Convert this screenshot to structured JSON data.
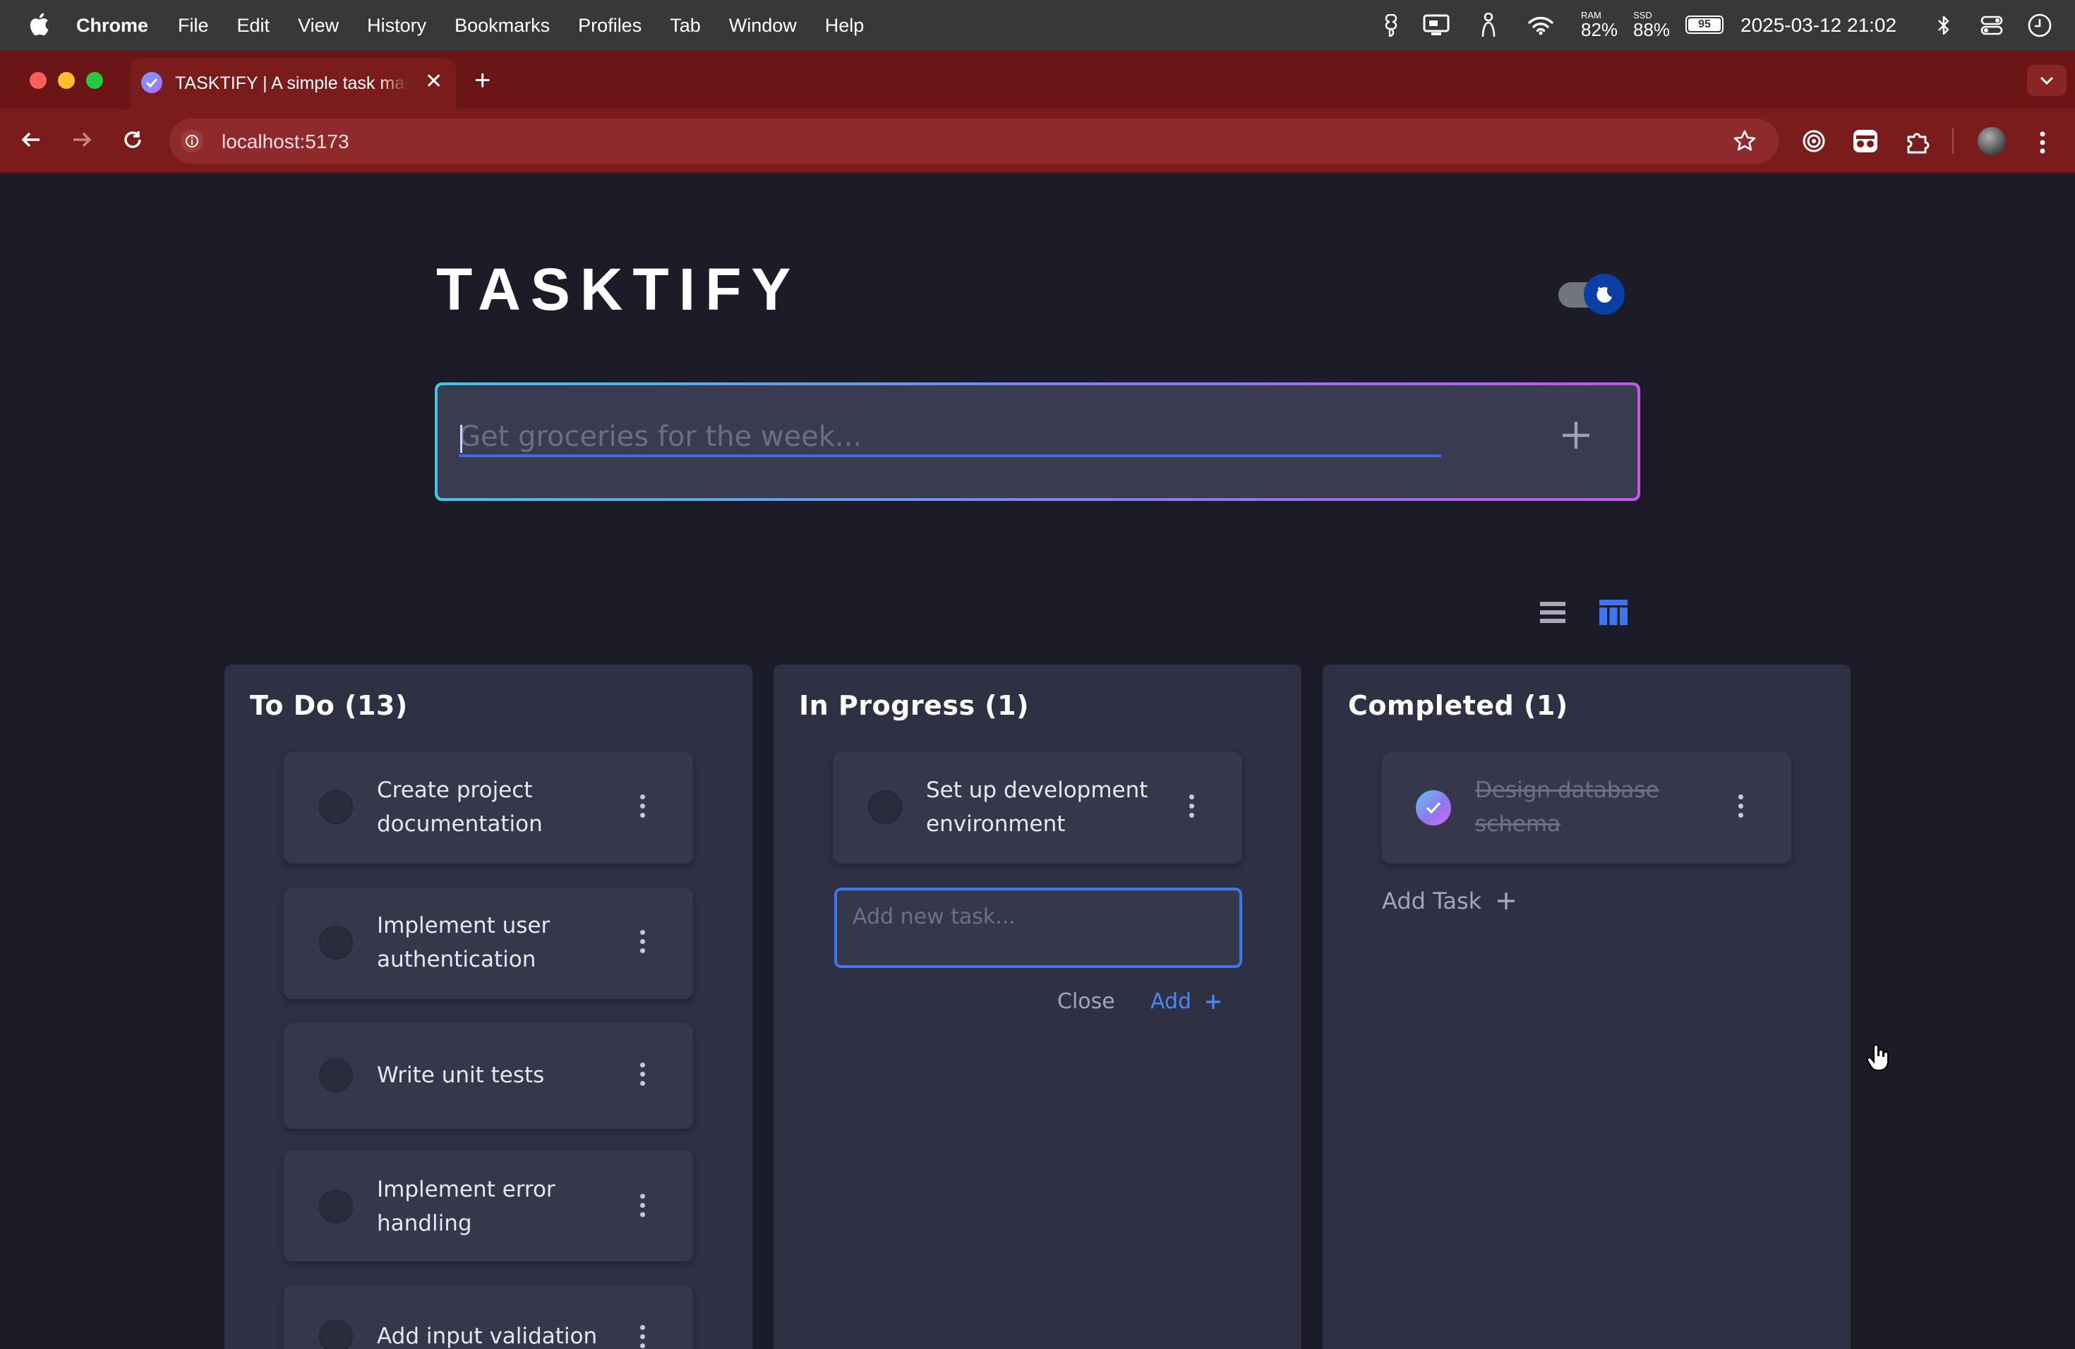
{
  "menubar": {
    "app_name": "Chrome",
    "items": [
      "File",
      "Edit",
      "View",
      "History",
      "Bookmarks",
      "Profiles",
      "Tab",
      "Window",
      "Help"
    ],
    "ram_label": "RAM",
    "ram_value": "82%",
    "ssd_label": "SSD",
    "ssd_value": "88%",
    "battery": "95",
    "datetime": "2025-03-12 21:02"
  },
  "browser": {
    "tab_title": "TASKTIFY | A simple task manager",
    "url": "localhost:5173"
  },
  "app": {
    "logo": "TASKTIFY",
    "main_input_placeholder": "Get groceries for the week...",
    "columns": [
      {
        "title": "To Do (13)",
        "cards": [
          {
            "text": "Create project documentation"
          },
          {
            "text": "Implement user authentication"
          },
          {
            "text": "Write unit tests"
          },
          {
            "text": "Implement error handling"
          },
          {
            "text": "Add input validation"
          }
        ]
      },
      {
        "title": "In Progress (1)",
        "cards": [
          {
            "text": "Set up development environment"
          }
        ],
        "new_task_placeholder": "Add new task...",
        "close_label": "Close",
        "add_label": "Add"
      },
      {
        "title": "Completed (1)",
        "cards": [
          {
            "text": "Design database schema",
            "completed": true
          }
        ],
        "add_task_label": "Add Task"
      }
    ]
  },
  "colors": {
    "accent_blue": "#3d76f2",
    "gradient_start": "#43c5e8",
    "gradient_end": "#c655e8",
    "page_bg": "#1b1c28",
    "column_bg": "#2e3044",
    "browser_frame": "#7a1b1c"
  }
}
